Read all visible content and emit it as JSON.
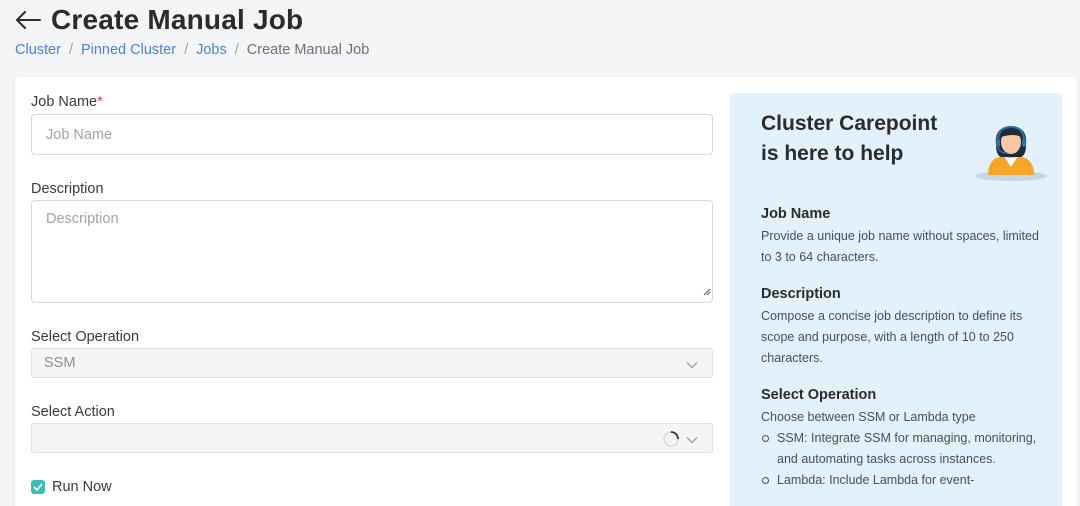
{
  "header": {
    "title": "Create Manual Job",
    "back_icon": "arrow-left-icon"
  },
  "breadcrumb": {
    "items": [
      "Cluster",
      "Pinned Cluster",
      "Jobs"
    ],
    "current": "Create Manual Job",
    "separator": "/"
  },
  "form": {
    "job_name": {
      "label": "Job Name",
      "required_mark": "*",
      "placeholder": "Job Name",
      "value": ""
    },
    "description": {
      "label": "Description",
      "placeholder": "Description",
      "value": ""
    },
    "operation": {
      "label": "Select Operation",
      "selected": "SSM"
    },
    "action": {
      "label": "Select Action",
      "selected": "",
      "loading": true
    },
    "run_now": {
      "label": "Run Now",
      "checked": true
    }
  },
  "help": {
    "title": "Cluster Carepoint is here to help",
    "icon": "support-agent-icon",
    "sections": [
      {
        "heading": "Job Name",
        "text": "Provide a unique job name without spaces, limited to 3 to 64 characters."
      },
      {
        "heading": "Description",
        "text": "Compose a concise job description to define its scope and purpose, with a length of 10 to 250 characters."
      },
      {
        "heading": "Select Operation",
        "text": "Choose between SSM or Lambda type",
        "bullets": [
          "SSM: Integrate SSM for managing, monitoring, and automating tasks across instances.",
          "Lambda: Include Lambda for event-"
        ]
      }
    ]
  },
  "colors": {
    "link": "#4a7fd6",
    "required": "#e0383e",
    "checkbox": "#3bbdb4",
    "help_bg": "#e3f1fd"
  }
}
